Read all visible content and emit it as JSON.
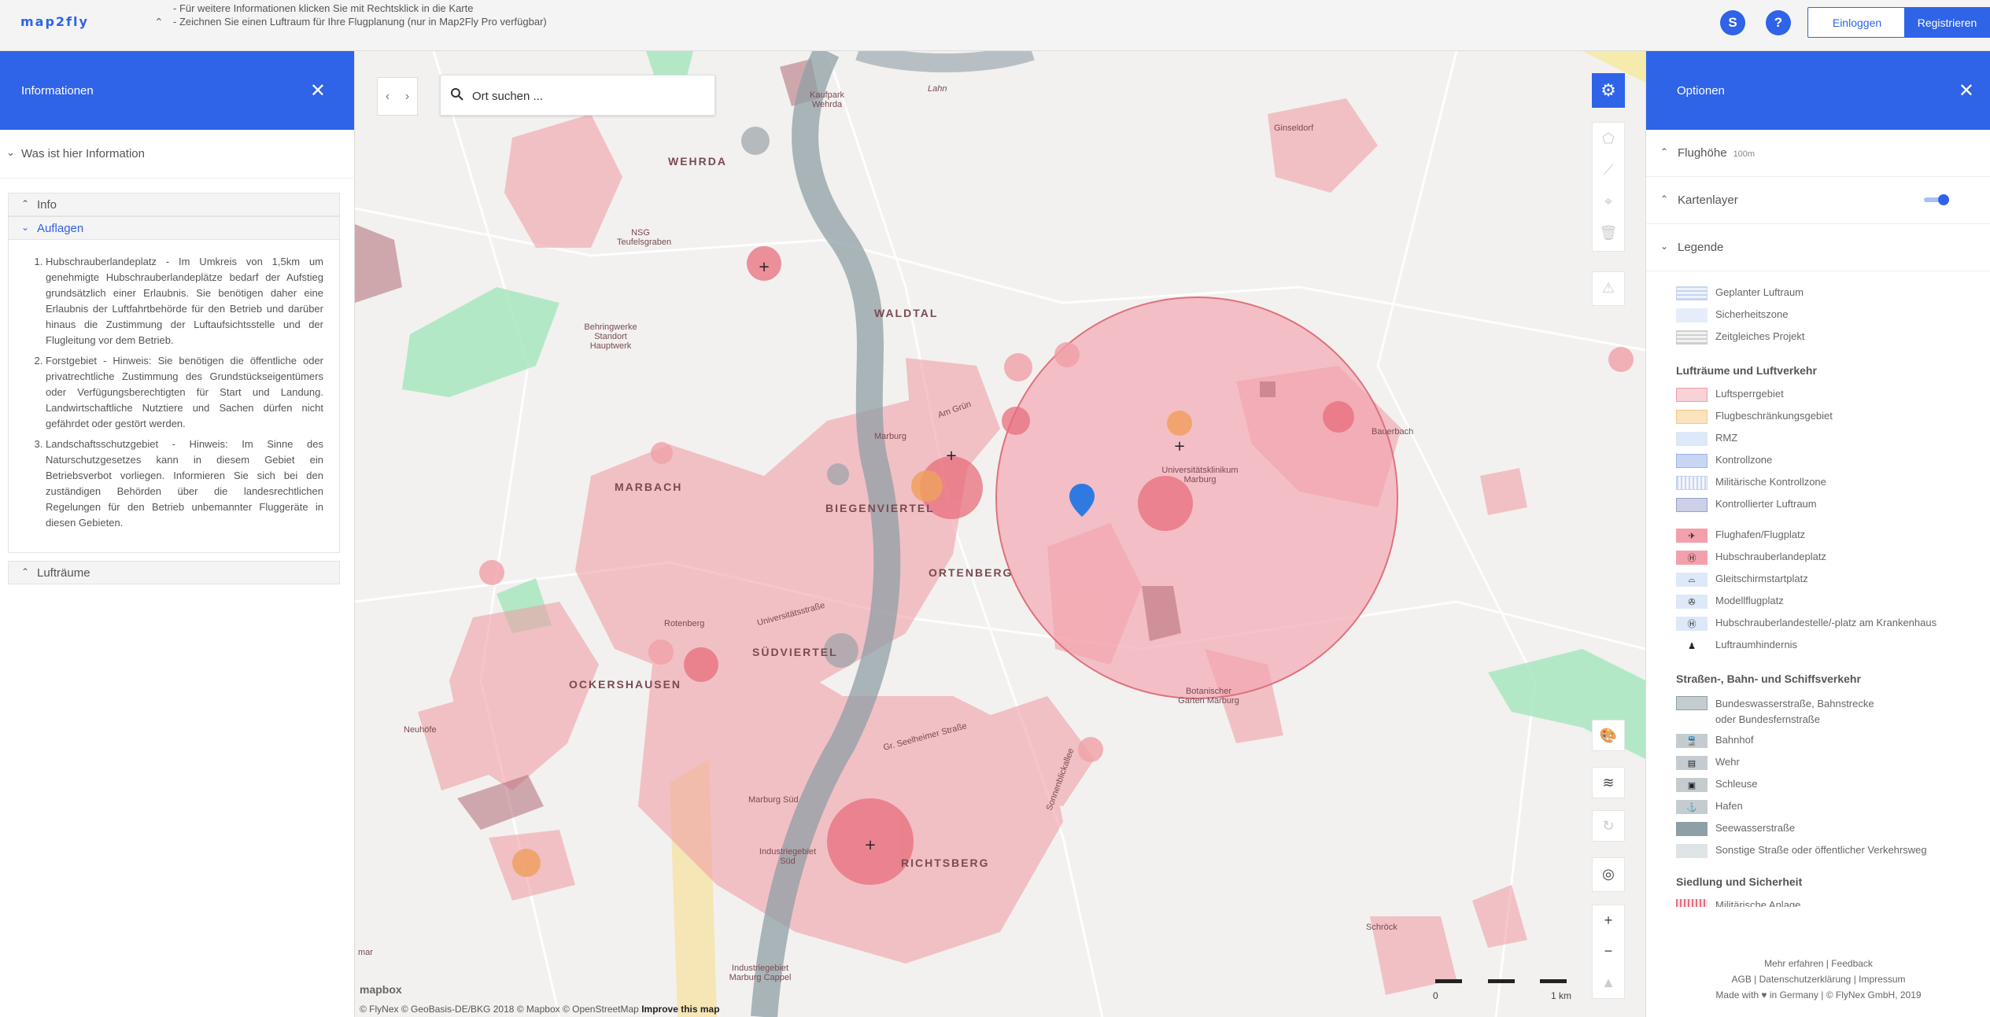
{
  "app": {
    "logo": "map2fly"
  },
  "topbar": {
    "hint_line_1": "- Für weitere Informationen klicken Sie mit Rechtsklick in die Karte",
    "hint_line_2": "- Zeichnen Sie einen Luftraum für Ihre Flugplanung (nur in Map2Fly Pro verfügbar)",
    "avatar_letter": "S",
    "help_label": "?",
    "login_label": "Einloggen",
    "register_label": "Registrieren"
  },
  "left_panel": {
    "title": "Informationen",
    "what_is": "Was ist hier Information",
    "sections": {
      "info": "Info",
      "auflagen": "Auflagen",
      "luftraeume": "Lufträume"
    },
    "auflagen_items": [
      "Hubschrauberlandeplatz - Im Umkreis von 1,5km um genehmigte Hubschrauberlandeplätze bedarf der Aufstieg grundsätzlich einer Erlaubnis. Sie benötigen daher eine Erlaubnis der Luftfahrtbehörde für den Betrieb und darüber hinaus die Zustimmung der Luftaufsichtsstelle und der Flugleitung vor dem Betrieb.",
      "Forstgebiet - Hinweis: Sie benötigen die öffentliche oder privatrechtliche Zustimmung des Grundstückseigentümers oder Verfügungsberechtigten für Start und Landung. Landwirtschaftliche Nutztiere und Sachen dürfen nicht gefährdet oder gestört werden.",
      "Landschaftsschutzgebiet - Hinweis: Im Sinne des Naturschutzgesetzes kann in diesem Gebiet ein Betriebsverbot vorliegen. Informieren Sie sich bei den zuständigen Behörden über die landesrechtlichen Regelungen für den Betrieb unbemannter Fluggeräte in diesen Gebieten."
    ]
  },
  "map": {
    "search_placeholder": "Ort suchen ...",
    "labels": {
      "wehrda": "WEHRDA",
      "waldtal": "WALDTAL",
      "marbach": "MARBACH",
      "biegenviertel": "BIEGENVIERTEL",
      "ortenberg": "ORTENBERG",
      "suedviertel": "SÜDVIERTEL",
      "ockershausen": "OCKERSHAUSEN",
      "richtsberg": "RICHTSBERG",
      "ginseldorf": "Ginseldorf",
      "bauerbach": "Bauerbach",
      "schroeck": "Schröck",
      "lahn": "Lahn",
      "marburg": "Marburg",
      "uniklinik": "Universitätsklinikum Marburg",
      "botanischer_garten": "Botanischer Garten Marburg",
      "nsg": "NSG Teufelsgraben",
      "behringwerke": "Behringwerke Standort Hauptwerk",
      "rotenberg": "Rotenberg",
      "neuhoefe": "Neuhöfe",
      "marburg_sued": "Marburg Süd",
      "industriegebiet_sued": "Industriegebiet Süd",
      "industriegebiet_marburg": "Industriegebiet Marburg Cappel",
      "universitaetsstrasse": "Universitätsstraße",
      "grossseelheimer": "Gr. Seelheimer Straße",
      "am_grun": "Am Grün",
      "sonnenblickallee": "Sonnenblickallee",
      "kaufpark": "Kaufpark Wehrda",
      "mar": "mar"
    },
    "attribution_text": "© FlyNex © GeoBasis-DE/BKG 2018 © Mapbox © OpenStreetMap",
    "attribution_link": "Improve this map",
    "mapbox_logo": "mapbox",
    "scale_0": "0",
    "scale_1": "1 km"
  },
  "right_panel": {
    "title": "Optionen",
    "flughoehe": "Flughöhe",
    "flughoehe_value": "100m",
    "kartenlayer": "Kartenlayer",
    "legende": "Legende",
    "legend_top": [
      "Geplanter Luftraum",
      "Sicherheitszone",
      "Zeitgleiches Projekt"
    ],
    "group_luft": "Lufträume und Luftverkehr",
    "legend_luft": [
      "Luftsperrgebiet",
      "Flugbeschränkungsgebiet",
      "RMZ",
      "Kontrollzone",
      "Militärische Kontrollzone",
      "Kontrollierter Luftraum"
    ],
    "legend_luft_icons": [
      "Flughafen/Flugplatz",
      "Hubschrauberlandeplatz",
      "Gleitschirmstartplatz",
      "Modellflugplatz",
      "Hubschrauberlandestelle/-platz am Krankenhaus",
      "Luftraumhindernis"
    ],
    "group_strasse": "Straßen-, Bahn- und Schiffsverkehr",
    "legend_strasse": [
      "Bundeswasserstraße, Bahnstrecke oder Bundesfernstraße",
      "Bahnhof",
      "Wehr",
      "Schleuse",
      "Hafen",
      "Seewasserstraße",
      "Sonstige Straße oder öffentlicher Verkehrsweg"
    ],
    "group_siedlung": "Siedlung und Sicherheit",
    "legend_siedlung_partial": "Militärische Anlage",
    "footer_1": "Mehr erfahren | Feedback",
    "footer_2": "AGB | Datenschutzerklärung | Impressum",
    "footer_3": "Made with ♥ in Germany | © FlyNex GmbH, 2019"
  },
  "colors": {
    "accent": "#2f63e8",
    "restricted": "#f0a0a8",
    "restricted_dark": "#c9808a",
    "water": "#a9b8bd",
    "forest": "#a8e6c0"
  }
}
